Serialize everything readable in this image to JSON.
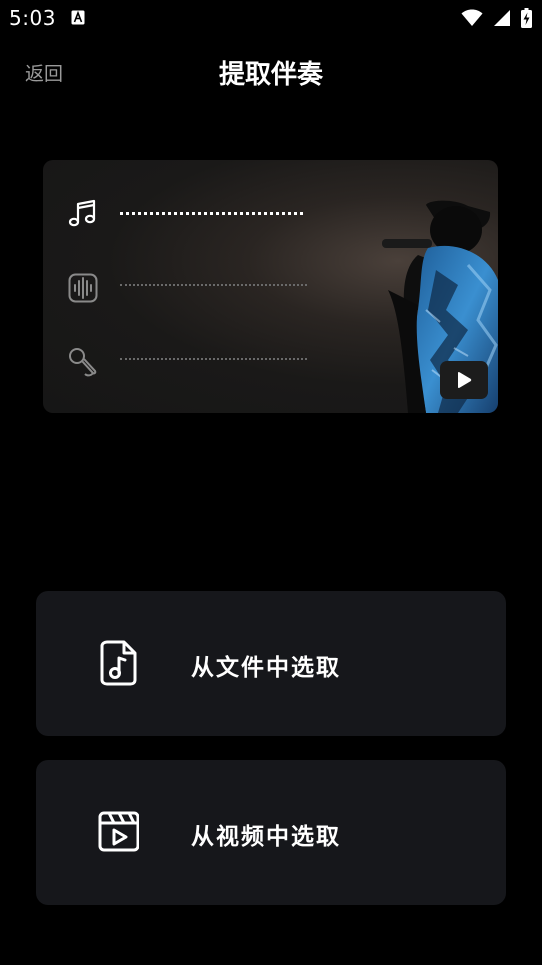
{
  "status": {
    "time": "5:03",
    "icons": [
      "notification-a-icon",
      "wifi-icon",
      "signal-icon",
      "battery-charging-icon"
    ]
  },
  "nav": {
    "back_label": "返回",
    "title": "提取伴奏"
  },
  "preview": {
    "tracks": [
      {
        "icon": "music-note-icon",
        "state": "active"
      },
      {
        "icon": "waveform-icon",
        "state": "inactive"
      },
      {
        "icon": "microphone-icon",
        "state": "inactive"
      }
    ],
    "play_icon": "play-icon"
  },
  "options": [
    {
      "label": "从文件中选取",
      "icon": "audio-file-icon"
    },
    {
      "label": "从视频中选取",
      "icon": "video-clapper-icon"
    }
  ],
  "colors": {
    "background": "#000000",
    "card": "#16171b",
    "back_text": "#9a9a9a"
  }
}
